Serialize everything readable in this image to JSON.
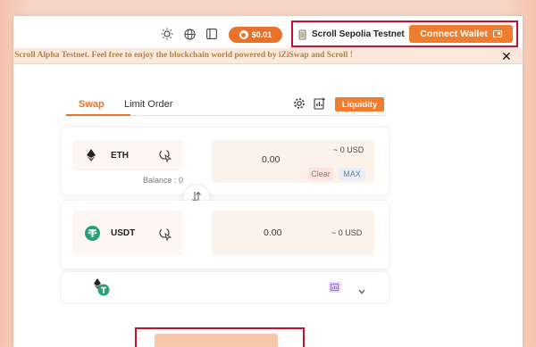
{
  "header": {
    "icons": [
      "sun-icon",
      "globe-icon",
      "sidebar-toggle-icon"
    ],
    "balance": "$0.01",
    "network": "Scroll Sepolia Testnet",
    "connect_wallet": "Connect Wallet"
  },
  "banner": {
    "text": "a Scroll Alpha Testnet. Feel free to enjoy the blockchain world powered by iZiSwap and Scroll !",
    "close": "✕"
  },
  "tabs": {
    "swap": "Swap",
    "limit_order": "Limit Order",
    "liquidity": "Liquidity"
  },
  "from": {
    "token": "ETH",
    "amount": "0.00",
    "usd": "~ 0 USD",
    "clear": "Clear",
    "max": "MAX",
    "balance": "Balance : 0"
  },
  "to": {
    "token": "USDT",
    "amount": "0.00",
    "usd": "~ 0 USD"
  },
  "colors": {
    "accent": "#ee7d2f",
    "highlight_box": "#c8102e",
    "banner_bg": "#fce9dc",
    "banner_text": "#b08244",
    "eth_color": "#222222",
    "usdt_color": "#26a17b"
  }
}
